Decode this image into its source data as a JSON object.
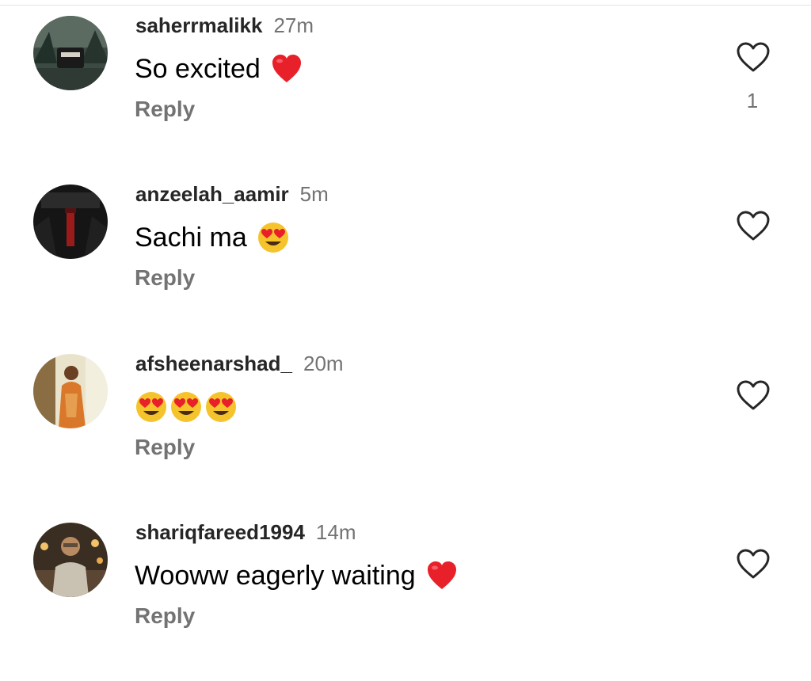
{
  "comments": [
    {
      "username": "saherrmalikk",
      "time": "27m",
      "text": "So excited",
      "emojis": [
        "red-heart"
      ],
      "reply": "Reply",
      "likes": "1"
    },
    {
      "username": "anzeelah_aamir",
      "time": "5m",
      "text": "Sachi ma",
      "emojis": [
        "heart-eyes"
      ],
      "reply": "Reply",
      "likes": ""
    },
    {
      "username": "afsheenarshad_",
      "time": "20m",
      "text": "",
      "emojis": [
        "heart-eyes",
        "heart-eyes",
        "heart-eyes"
      ],
      "reply": "Reply",
      "likes": ""
    },
    {
      "username": "shariqfareed1994",
      "time": "14m",
      "text": "Wooww eagerly waiting",
      "emojis": [
        "red-heart"
      ],
      "reply": "Reply",
      "likes": ""
    }
  ],
  "icons": {
    "like": "heart-outline-icon"
  },
  "colors": {
    "username": "#262626",
    "meta": "#737373",
    "heart_emoji": "#e8202a",
    "face_emoji": "#f5c32c"
  }
}
